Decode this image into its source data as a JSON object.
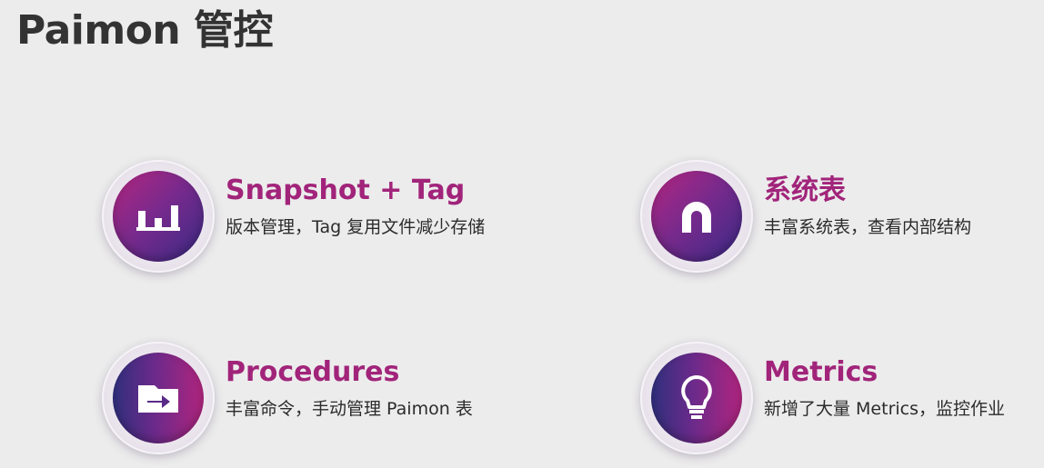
{
  "page": {
    "title": "Paimon 管控"
  },
  "colors": {
    "background": "#ececec",
    "title_text": "#333333",
    "feature_title": "#a1247a",
    "icon_gradient_start": "#b4257f",
    "icon_gradient_end": "#3a2a86"
  },
  "features": [
    {
      "title": "Snapshot + Tag",
      "description": "版本管理，Tag 复用文件减少存储",
      "icon": "bar-chart-icon"
    },
    {
      "title": "系统表",
      "description": "丰富系统表，查看内部结构",
      "icon": "magnet-icon"
    },
    {
      "title": "Procedures",
      "description": "丰富命令，手动管理 Paimon 表",
      "icon": "folder-arrow-icon"
    },
    {
      "title": "Metrics",
      "description": "新增了大量 Metrics，监控作业",
      "icon": "lightbulb-icon"
    }
  ]
}
